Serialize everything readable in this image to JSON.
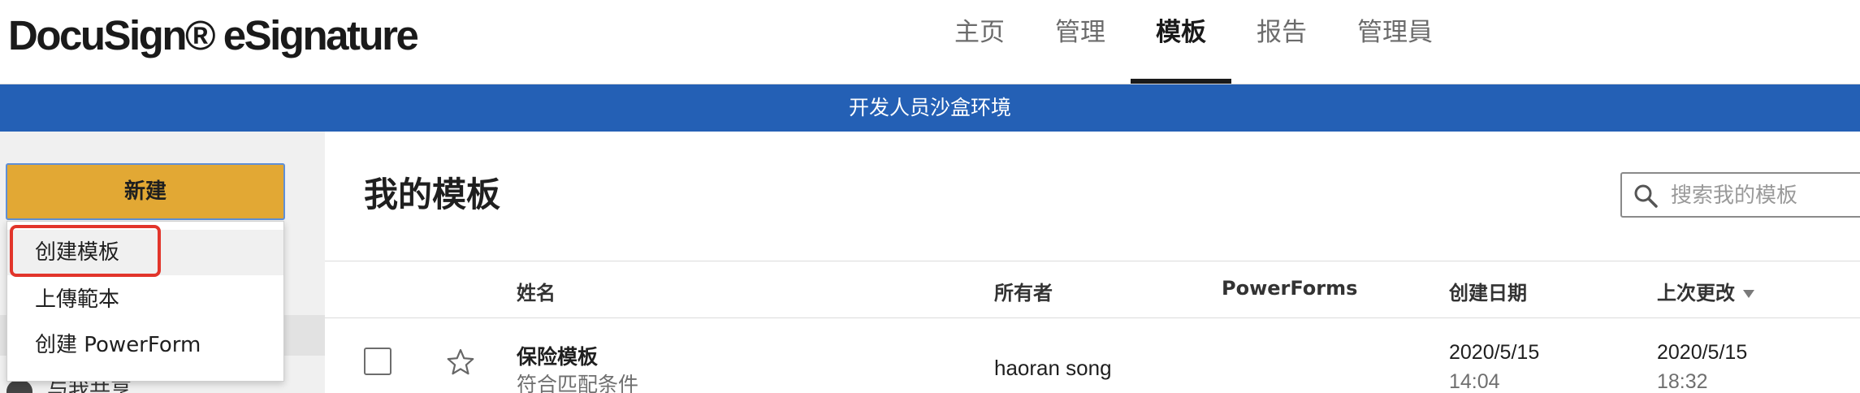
{
  "header": {
    "logo": "DocuSign® eSignature",
    "nav": [
      {
        "label": "主页"
      },
      {
        "label": "管理"
      },
      {
        "label": "模板"
      },
      {
        "label": "报告"
      },
      {
        "label": "管理員"
      }
    ],
    "active_tab": "模板"
  },
  "banner": {
    "text": "开发人员沙盒环境"
  },
  "sidebar": {
    "new_button_label": "新建",
    "dropdown": [
      {
        "label": "创建模板"
      },
      {
        "label": "上傳範本"
      },
      {
        "label": "创建 PowerForm"
      }
    ],
    "peek_label": "与我共享"
  },
  "main": {
    "title": "我的模板",
    "search": {
      "placeholder": "搜索我的模板",
      "value": ""
    },
    "columns": [
      "姓名",
      "所有者",
      "PowerForms",
      "创建日期",
      "上次更改"
    ],
    "sorted_column": "上次更改",
    "sort_direction": "descending",
    "rows": [
      {
        "name": "保险模板",
        "status": "符合匹配条件",
        "owner": "haoran song",
        "powerforms": "",
        "created_date": "2020/5/15",
        "created_time": "14:04",
        "modified_date": "2020/5/15",
        "modified_time": "18:32",
        "checked": false,
        "starred": false
      }
    ]
  },
  "colors": {
    "banner": "#2460b5",
    "new_button": "#e2a834",
    "highlight": "#e2352b"
  }
}
